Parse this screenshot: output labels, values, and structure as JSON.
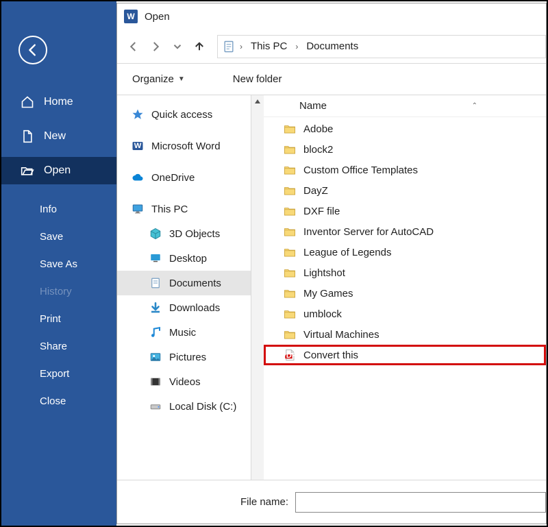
{
  "backstage": {
    "back_label": "Back",
    "main": [
      {
        "key": "home",
        "label": "Home",
        "icon": "home-icon"
      },
      {
        "key": "new",
        "label": "New",
        "icon": "file-icon"
      },
      {
        "key": "open",
        "label": "Open",
        "icon": "open-folder-icon",
        "selected": true
      }
    ],
    "sub": [
      {
        "key": "info",
        "label": "Info"
      },
      {
        "key": "save",
        "label": "Save"
      },
      {
        "key": "saveas",
        "label": "Save As"
      },
      {
        "key": "history",
        "label": "History",
        "disabled": true
      },
      {
        "key": "print",
        "label": "Print"
      },
      {
        "key": "share",
        "label": "Share"
      },
      {
        "key": "export",
        "label": "Export"
      },
      {
        "key": "close",
        "label": "Close"
      }
    ]
  },
  "dialog": {
    "title": "Open",
    "app_icon_letter": "W",
    "breadcrumbs": [
      "This PC",
      "Documents"
    ],
    "toolbar": {
      "organize": "Organize",
      "new_folder": "New folder"
    },
    "tree": [
      {
        "key": "quick",
        "label": "Quick access",
        "icon": "star-icon",
        "level": 0
      },
      {
        "key": "word",
        "label": "Microsoft Word",
        "icon": "word-icon",
        "level": 0
      },
      {
        "key": "onedrive",
        "label": "OneDrive",
        "icon": "cloud-icon",
        "level": 0
      },
      {
        "key": "thispc",
        "label": "This PC",
        "icon": "monitor-icon",
        "level": 0
      },
      {
        "key": "3d",
        "label": "3D Objects",
        "icon": "cube-icon",
        "level": 1
      },
      {
        "key": "desktop",
        "label": "Desktop",
        "icon": "desktop-icon",
        "level": 1
      },
      {
        "key": "documents",
        "label": "Documents",
        "icon": "documents-icon",
        "level": 1,
        "selected": true
      },
      {
        "key": "downloads",
        "label": "Downloads",
        "icon": "download-icon",
        "level": 1
      },
      {
        "key": "music",
        "label": "Music",
        "icon": "music-icon",
        "level": 1
      },
      {
        "key": "pictures",
        "label": "Pictures",
        "icon": "pictures-icon",
        "level": 1
      },
      {
        "key": "videos",
        "label": "Videos",
        "icon": "videos-icon",
        "level": 1
      },
      {
        "key": "localc",
        "label": "Local Disk (C:)",
        "icon": "drive-icon",
        "level": 1
      }
    ],
    "columns": {
      "name": "Name"
    },
    "rows": [
      {
        "label": "Adobe",
        "type": "folder"
      },
      {
        "label": "block2",
        "type": "folder"
      },
      {
        "label": "Custom Office Templates",
        "type": "folder"
      },
      {
        "label": "DayZ",
        "type": "folder"
      },
      {
        "label": "DXF file",
        "type": "folder"
      },
      {
        "label": "Inventor Server for AutoCAD",
        "type": "folder"
      },
      {
        "label": "League of Legends",
        "type": "folder"
      },
      {
        "label": "Lightshot",
        "type": "folder"
      },
      {
        "label": "My Games",
        "type": "folder"
      },
      {
        "label": "umblock",
        "type": "folder"
      },
      {
        "label": "Virtual Machines",
        "type": "folder"
      },
      {
        "label": "Convert this",
        "type": "pdf",
        "highlight": true
      }
    ],
    "footer": {
      "file_name_label": "File name:",
      "file_name_value": ""
    }
  }
}
